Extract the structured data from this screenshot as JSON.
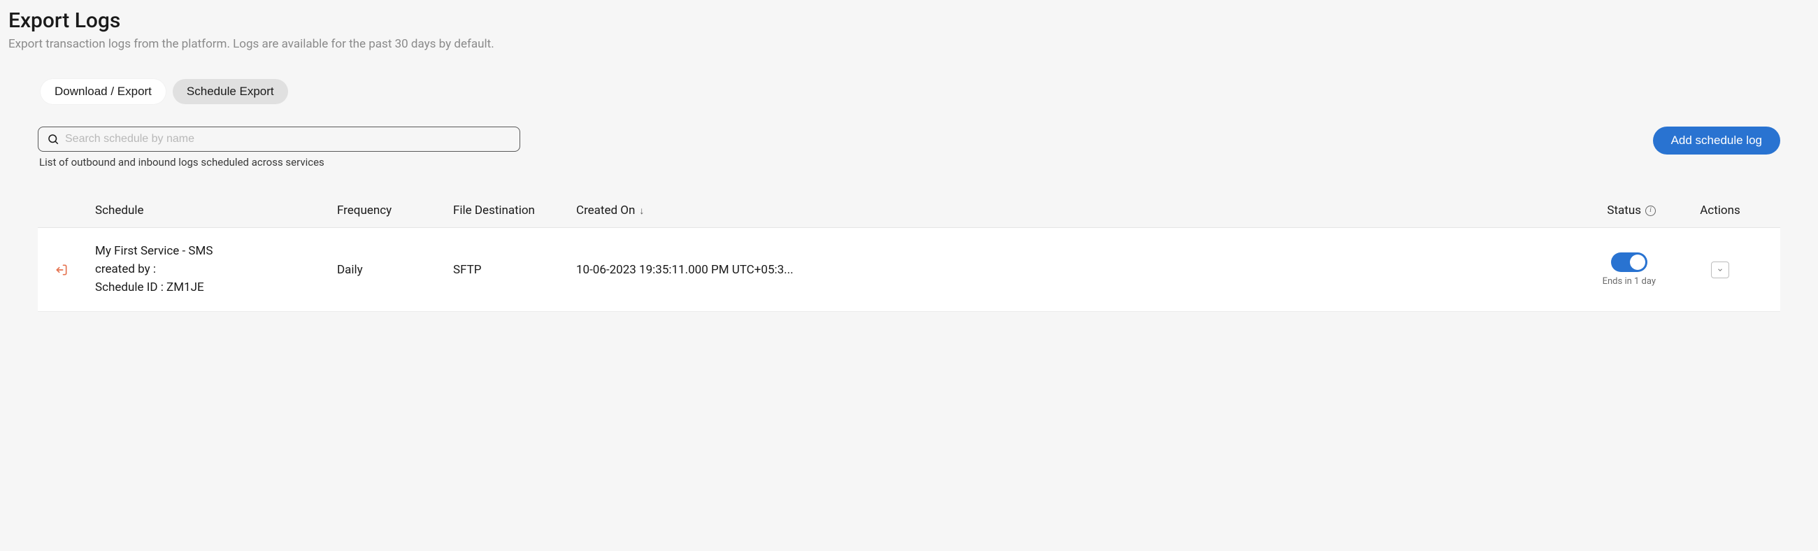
{
  "header": {
    "title": "Export Logs",
    "subtitle": "Export transaction logs from the platform. Logs are available for the past 30 days by default."
  },
  "tabs": {
    "download": "Download / Export",
    "schedule": "Schedule Export"
  },
  "search": {
    "placeholder": "Search schedule by name",
    "caption": "List of outbound and inbound logs scheduled across services"
  },
  "buttons": {
    "add_schedule": "Add schedule log"
  },
  "table": {
    "headers": {
      "schedule": "Schedule",
      "frequency": "Frequency",
      "file_destination": "File Destination",
      "created_on": "Created On",
      "status": "Status",
      "actions": "Actions"
    },
    "rows": [
      {
        "schedule_name": "My First Service - SMS",
        "created_by_label": "created by :",
        "schedule_id_label": "Schedule ID : ZM1JE",
        "frequency": "Daily",
        "file_destination": "SFTP",
        "created_on": "10-06-2023 19:35:11.000 PM UTC+05:3...",
        "status_caption": "Ends in 1 day"
      }
    ]
  }
}
